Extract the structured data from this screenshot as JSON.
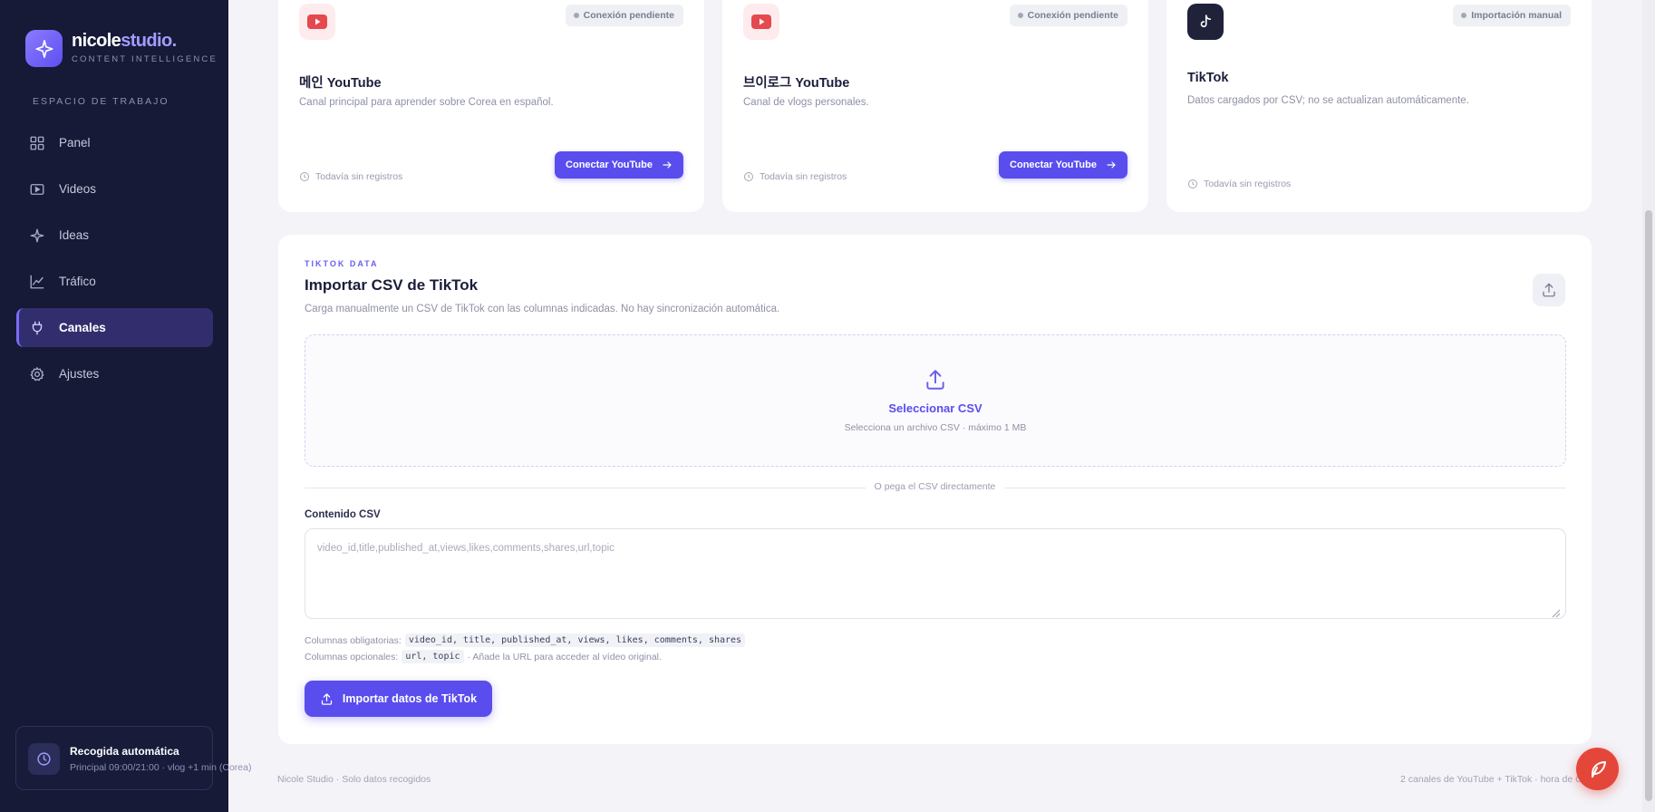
{
  "brand": {
    "name_main": "nicole",
    "name_accent": "studio.",
    "subtitle": "CONTENT INTELLIGENCE"
  },
  "sidebar": {
    "section_label": "ESPACIO DE TRABAJO",
    "items": [
      {
        "label": "Panel",
        "icon": "grid-icon"
      },
      {
        "label": "Videos",
        "icon": "video-icon"
      },
      {
        "label": "Ideas",
        "icon": "sparkle-icon"
      },
      {
        "label": "Tráfico",
        "icon": "chart-line-icon"
      },
      {
        "label": "Canales",
        "icon": "plug-icon",
        "active": true
      },
      {
        "label": "Ajustes",
        "icon": "gear-icon"
      }
    ],
    "auto_collect": {
      "title": "Recogida automática",
      "subtitle": "Principal 09:00/21:00 · vlog +1 min (Corea)"
    }
  },
  "channels": [
    {
      "name": "메인 YouTube",
      "description": "Canal principal para aprender sobre Corea en español.",
      "badge": "Conexión pendiente",
      "status": "Todavía sin registros",
      "button": "Conectar YouTube",
      "platform": "youtube"
    },
    {
      "name": "브이로그 YouTube",
      "description": "Canal de vlogs personales.",
      "badge": "Conexión pendiente",
      "status": "Todavía sin registros",
      "button": "Conectar YouTube",
      "platform": "youtube"
    },
    {
      "name": "TikTok",
      "description": "Datos cargados por CSV; no se actualizan automáticamente.",
      "badge": "Importación manual",
      "status": "Todavía sin registros",
      "platform": "tiktok"
    }
  ],
  "tiktok_import": {
    "eyebrow": "TIKTOK DATA",
    "title": "Importar CSV de TikTok",
    "description": "Carga manualmente un CSV de TikTok con las columnas indicadas. No hay sincronización automática.",
    "dropzone_title": "Seleccionar CSV",
    "dropzone_subtitle": "Selecciona un archivo CSV · máximo 1 MB",
    "divider": "O pega el CSV directamente",
    "field_label": "Contenido CSV",
    "placeholder": "video_id,title,published_at,views,likes,comments,shares,url,topic",
    "required_label": "Columnas obligatorias:",
    "required_columns": "video_id, title, published_at, views, likes, comments, shares",
    "optional_label": "Columnas opcionales:",
    "optional_columns": "url, topic",
    "optional_note": "· Añade la URL para acceder al vídeo original.",
    "button": "Importar datos de TikTok"
  },
  "footer": {
    "left": "Nicole Studio · Solo datos recogidos",
    "right": "2 canales de YouTube + TikTok · hora de Co"
  },
  "colors": {
    "accent": "#5a4dee",
    "sidebar_bg": "#161a36",
    "page_bg": "#f3f3f8",
    "youtube_red": "#e5484d",
    "fab": "#e4473a"
  }
}
